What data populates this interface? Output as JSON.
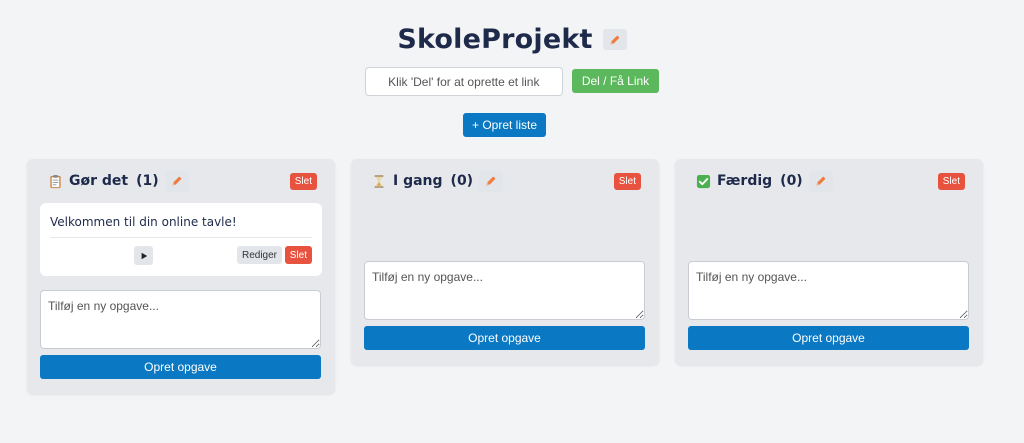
{
  "board": {
    "title": "SkoleProjekt"
  },
  "share": {
    "placeholder": "Klik 'Del' for at oprette et link",
    "button_label": "Del / Få Link"
  },
  "toolbar": {
    "create_list_label": "+ Opret liste"
  },
  "columns": [
    {
      "icon": "clipboard-icon",
      "title": "Gør det",
      "count": "(1)",
      "delete_label": "Slet",
      "cards": [
        {
          "text": "Velkommen til din online tavle!",
          "play_icon": "play-icon",
          "edit_label": "Rediger",
          "delete_label": "Slet"
        }
      ],
      "input_placeholder": "Tilføj en ny opgave...",
      "create_label": "Opret opgave"
    },
    {
      "icon": "hourglass-icon",
      "title": "I gang",
      "count": "(0)",
      "delete_label": "Slet",
      "cards": [],
      "input_placeholder": "Tilføj en ny opgave...",
      "create_label": "Opret opgave"
    },
    {
      "icon": "check-box-icon",
      "title": "Færdig",
      "count": "(0)",
      "delete_label": "Slet",
      "cards": [],
      "input_placeholder": "Tilføj en ny opgave...",
      "create_label": "Opret opgave"
    }
  ],
  "colors": {
    "primary": "#0a78c2",
    "success": "#5cb85c",
    "danger": "#e8533f",
    "background": "#f3f4f6",
    "column": "#e6e8ec"
  }
}
